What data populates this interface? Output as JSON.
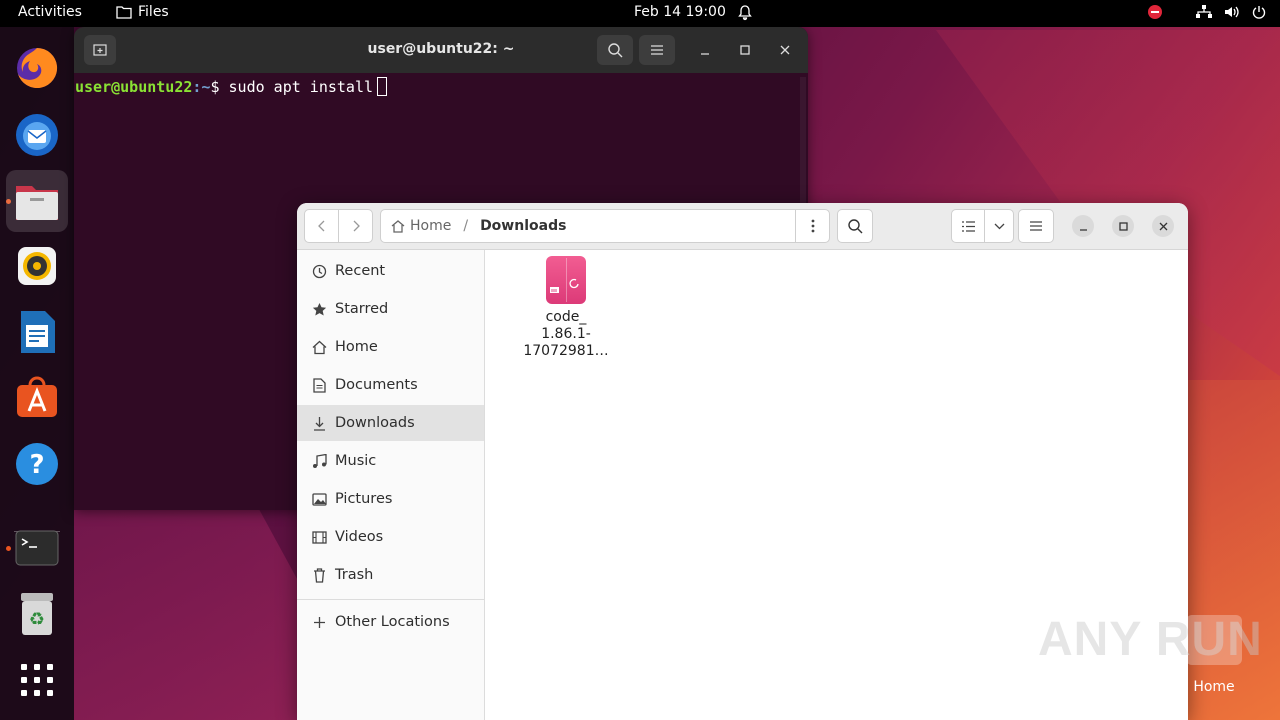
{
  "topbar": {
    "activities": "Activities",
    "app_name": "Files",
    "datetime": "Feb 14  19:00"
  },
  "dock": {
    "items": [
      "firefox",
      "thunderbird",
      "files",
      "rhythmbox",
      "libreoffice-writer",
      "app-center",
      "help",
      "terminal",
      "trash",
      "show-apps"
    ]
  },
  "terminal": {
    "title": "user@ubuntu22: ~",
    "prompt_user": "user@ubuntu22",
    "prompt_path": ":~",
    "prompt_symbol": "$",
    "command": "sudo apt install"
  },
  "files": {
    "breadcrumb_home": "Home",
    "breadcrumb_current": "Downloads",
    "sidebar": [
      {
        "label": "Recent",
        "icon": "clock-icon"
      },
      {
        "label": "Starred",
        "icon": "star-icon"
      },
      {
        "label": "Home",
        "icon": "home-icon"
      },
      {
        "label": "Documents",
        "icon": "document-icon"
      },
      {
        "label": "Downloads",
        "icon": "download-icon"
      },
      {
        "label": "Music",
        "icon": "music-icon"
      },
      {
        "label": "Pictures",
        "icon": "picture-icon"
      },
      {
        "label": "Videos",
        "icon": "video-icon"
      },
      {
        "label": "Trash",
        "icon": "trash-icon"
      },
      {
        "label": "Other Locations",
        "icon": "plus-icon"
      }
    ],
    "selected_sidebar": "Downloads",
    "file": {
      "line1": "code_",
      "line2": "1.86.1-",
      "line3": "17072981…"
    }
  },
  "desktop": {
    "home_label": "Home",
    "watermark": "ANY RUN"
  },
  "colors": {
    "accent": "#e95420",
    "terminal_bg": "#300a24",
    "prompt_user": "#8ae234",
    "prompt_path": "#729fcf"
  }
}
